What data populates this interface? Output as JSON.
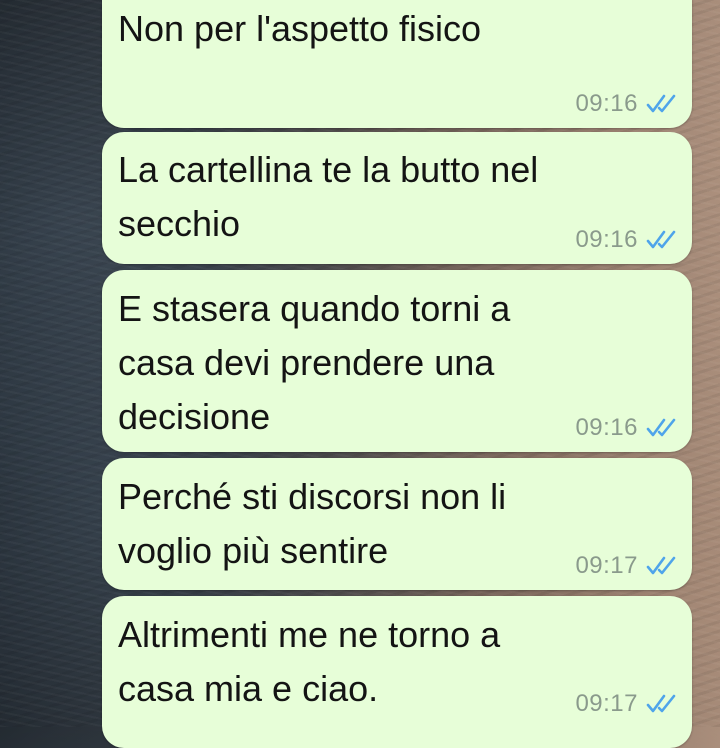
{
  "colors": {
    "bubble_bg": "#e7fed8",
    "text": "#141414",
    "time": "#8a9a8c",
    "read_ticks": "#4fa4ea"
  },
  "messages": [
    {
      "text": "Non per l'aspetto fisico",
      "time": "09:16",
      "status_icon": "double-check-read-icon"
    },
    {
      "text": "La cartellina te la butto nel secchio",
      "time": "09:16",
      "status_icon": "double-check-read-icon"
    },
    {
      "text": "E stasera quando torni a casa devi prendere una decisione",
      "time": "09:16",
      "status_icon": "double-check-read-icon"
    },
    {
      "text": "Perché sti discorsi non li voglio più sentire",
      "time": "09:17",
      "status_icon": "double-check-read-icon"
    },
    {
      "text": "Altrimenti me ne torno a casa mia e ciao.",
      "time": "09:17",
      "status_icon": "double-check-read-icon"
    }
  ]
}
